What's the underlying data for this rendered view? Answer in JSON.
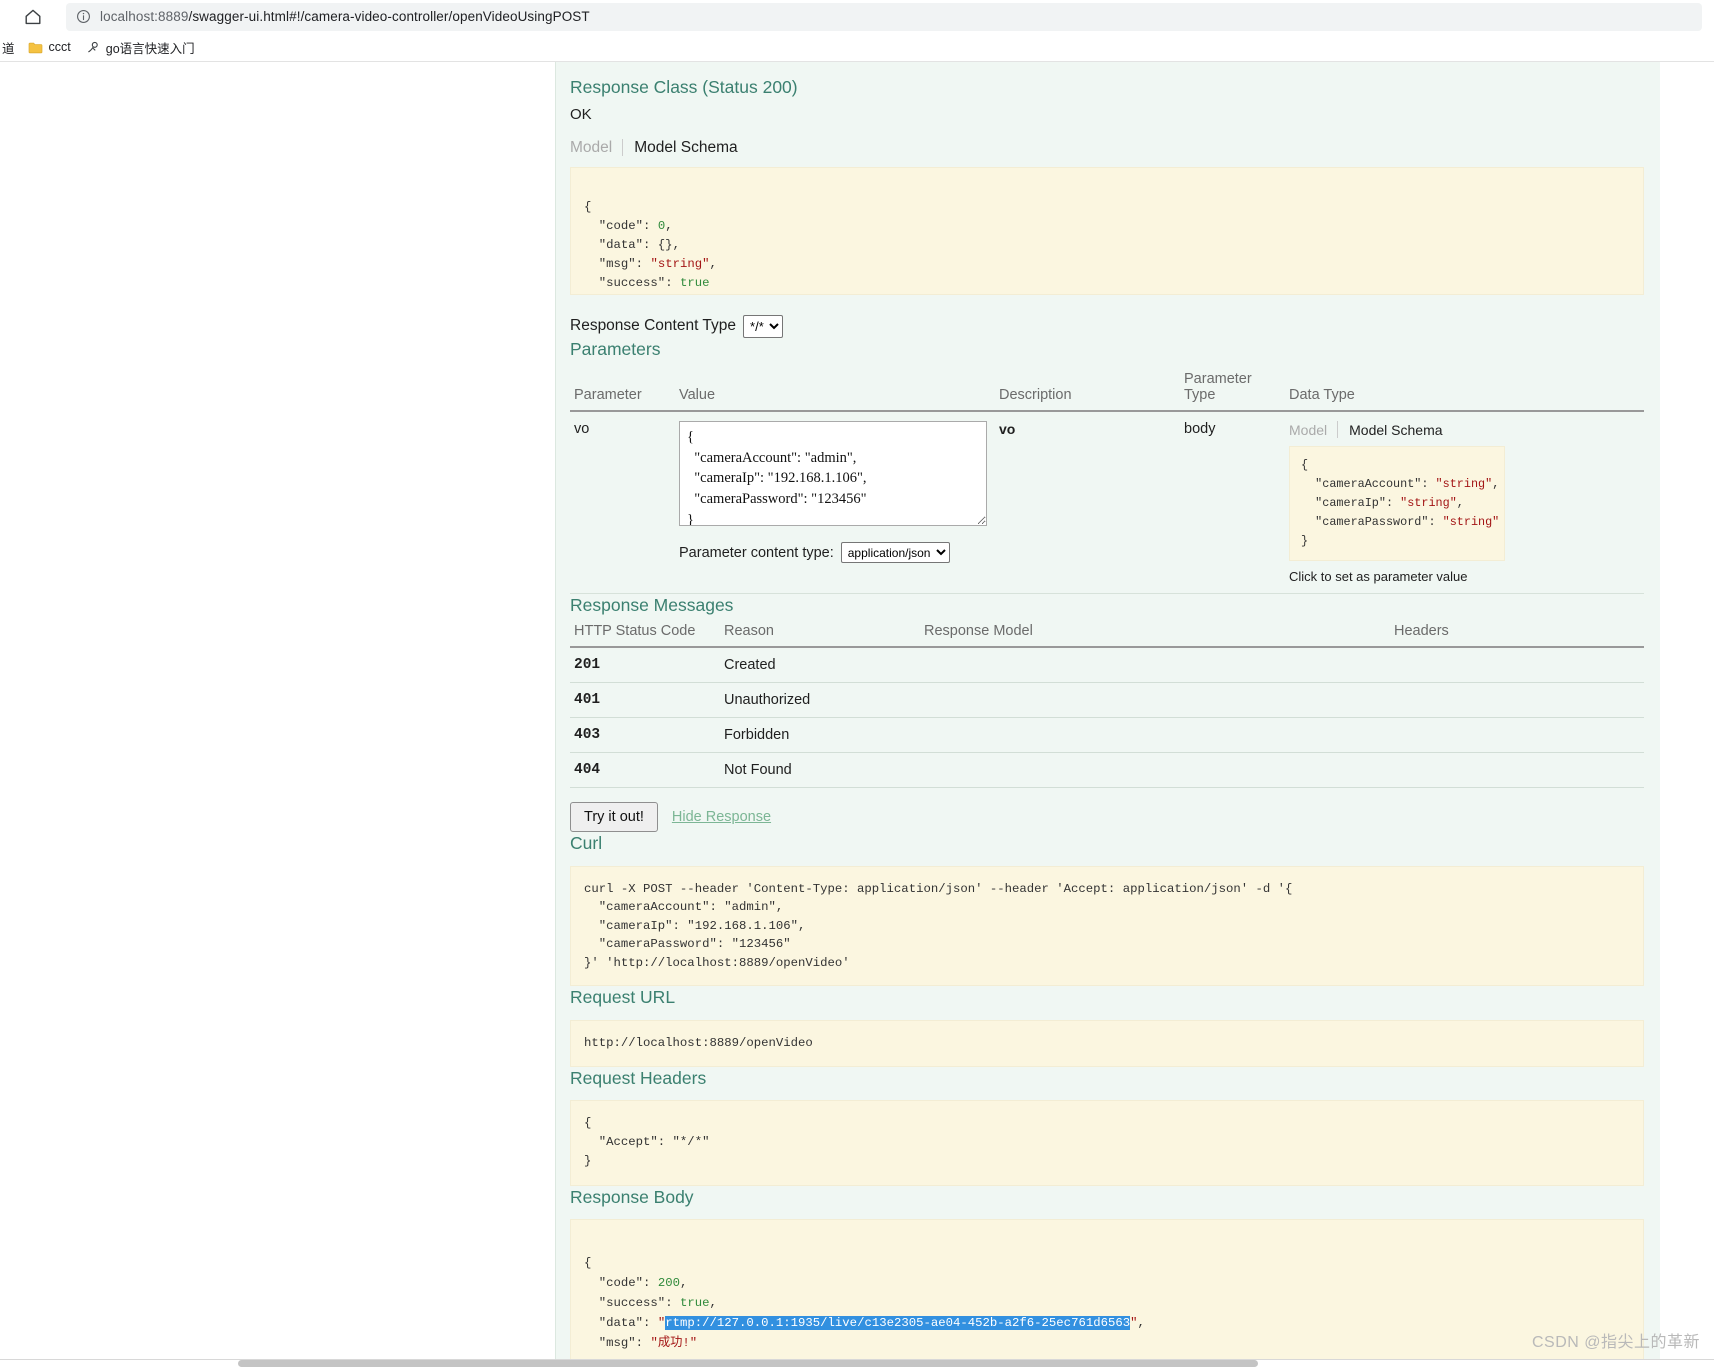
{
  "browser": {
    "url_host": "localhost:8889",
    "url_path": "/swagger-ui.html#!/camera-video-controller/openVideoUsingPOST",
    "home_icon": "home-icon",
    "info_icon": "info-circle-icon",
    "bookmarks": [
      {
        "label": "道",
        "icon": "partial-bookmark-icon"
      },
      {
        "label": "ccct",
        "icon": "folder-icon"
      },
      {
        "label": "go语言快速入门",
        "icon": "site-favicon-icon"
      }
    ]
  },
  "swagger": {
    "response_class": {
      "title": "Response Class (Status 200)",
      "ok_text": "OK",
      "tabs": {
        "model": "Model",
        "model_schema": "Model Schema"
      },
      "schema_lines": [
        {
          "punc": "{"
        },
        {
          "key": "\"code\"",
          "sep": ": ",
          "num": "0",
          "tail": ","
        },
        {
          "key": "\"data\"",
          "sep": ": ",
          "punc2": "{}",
          "tail": ","
        },
        {
          "key": "\"msg\"",
          "sep": ": ",
          "str": "\"string\"",
          "tail": ","
        },
        {
          "key": "\"success\"",
          "sep": ": ",
          "bool": "true"
        },
        {
          "punc": "}"
        }
      ],
      "schema_text": "{\n  \"code\": 0,\n  \"data\": {},\n  \"msg\": \"string\",\n  \"success\": true\n}"
    },
    "response_content_type": {
      "label": "Response Content Type",
      "value": "*/*",
      "options": [
        "*/*"
      ]
    },
    "parameters": {
      "title": "Parameters",
      "headers": [
        "Parameter",
        "Value",
        "Description",
        "Parameter Type",
        "Data Type"
      ],
      "row": {
        "parameter": "vo",
        "value": "{\n  \"cameraAccount\": \"admin\",\n  \"cameraIp\": \"192.168.1.106\",\n  \"cameraPassword\": \"123456\"\n}",
        "description": "vo",
        "parameter_type": "body",
        "data_type_tabs": {
          "model": "Model",
          "model_schema": "Model Schema"
        },
        "data_type_schema": "{\n  \"cameraAccount\": \"string\",\n  \"cameraIp\": \"string\",\n  \"cameraPassword\": \"string\"\n}",
        "click_hint": "Click to set as parameter value"
      },
      "content_type": {
        "label": "Parameter content type:",
        "value": "application/json",
        "options": [
          "application/json"
        ]
      }
    },
    "response_messages": {
      "title": "Response Messages",
      "headers": [
        "HTTP Status Code",
        "Reason",
        "Response Model",
        "Headers"
      ],
      "rows": [
        {
          "code": "201",
          "reason": "Created",
          "model": "",
          "headers": ""
        },
        {
          "code": "401",
          "reason": "Unauthorized",
          "model": "",
          "headers": ""
        },
        {
          "code": "403",
          "reason": "Forbidden",
          "model": "",
          "headers": ""
        },
        {
          "code": "404",
          "reason": "Not Found",
          "model": "",
          "headers": ""
        }
      ]
    },
    "actions": {
      "try_it_out": "Try it out!",
      "hide_response": "Hide Response"
    },
    "curl": {
      "title": "Curl",
      "text": "curl -X POST --header 'Content-Type: application/json' --header 'Accept: application/json' -d '{\n  \"cameraAccount\": \"admin\",\n  \"cameraIp\": \"192.168.1.106\",\n  \"cameraPassword\": \"123456\"\n}' 'http://localhost:8889/openVideo'"
    },
    "request_url": {
      "title": "Request URL",
      "text": "http://localhost:8889/openVideo"
    },
    "request_headers": {
      "title": "Request Headers",
      "text": "{\n  \"Accept\": \"*/*\"\n}"
    },
    "response_body": {
      "title": "Response Body",
      "code_key": "\"code\"",
      "code_value": "200",
      "success_key": "\"success\"",
      "success_value": "true",
      "data_key": "\"data\"",
      "data_value_highlighted": "rtmp://127.0.0.1:1935/live/c13e2305-ae04-452b-a2f6-25ec761d6563",
      "msg_key": "\"msg\"",
      "msg_value": "\"成功!\""
    }
  },
  "watermark": "CSDN @指尖上的革新",
  "colors": {
    "panel_bg": "#f0f7f3",
    "code_bg": "#fbf6e0",
    "heading_green": "#3b8070",
    "highlight_blue": "#3290e0",
    "string_red": "#a31515",
    "number_green": "#2f8a3b"
  }
}
